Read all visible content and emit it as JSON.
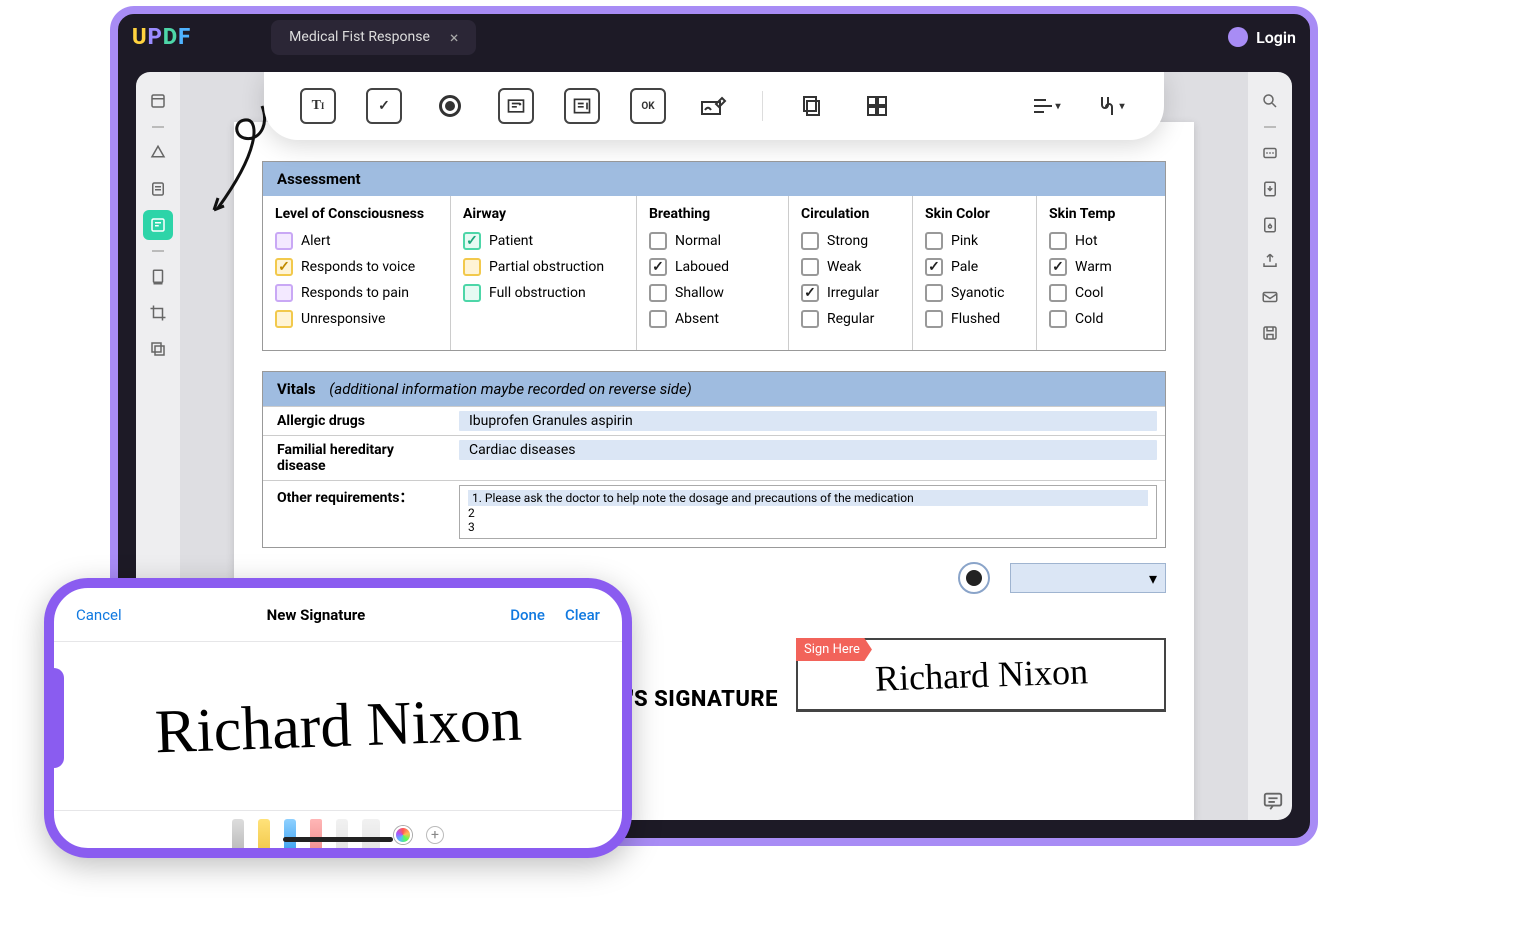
{
  "titlebar": {
    "logo": "UPDF",
    "tab": "Medical Fist Response",
    "login": "Login"
  },
  "toolbar": {
    "text_field": "T",
    "ok": "OK"
  },
  "assessment": {
    "title": "Assessment",
    "columns": [
      {
        "title": "Level of Consciousness",
        "style": "color",
        "options": [
          {
            "label": "Alert",
            "checked": false,
            "color": "purple"
          },
          {
            "label": "Responds to voice",
            "checked": true,
            "color": "yellow"
          },
          {
            "label": "Responds to pain",
            "checked": false,
            "color": "purple"
          },
          {
            "label": "Unresponsive",
            "checked": false,
            "color": "yellow"
          }
        ]
      },
      {
        "title": "Airway",
        "style": "color",
        "options": [
          {
            "label": "Patient",
            "checked": true,
            "color": "green"
          },
          {
            "label": "Partial obstruction",
            "checked": false,
            "color": "yellow"
          },
          {
            "label": "Full obstruction",
            "checked": false,
            "color": "green"
          }
        ]
      },
      {
        "title": "Breathing",
        "style": "plain",
        "options": [
          {
            "label": "Normal",
            "checked": false
          },
          {
            "label": "Laboued",
            "checked": true
          },
          {
            "label": "Shallow",
            "checked": false
          },
          {
            "label": "Absent",
            "checked": false
          }
        ]
      },
      {
        "title": "Circulation",
        "style": "plain",
        "options": [
          {
            "label": "Strong",
            "checked": false
          },
          {
            "label": "Weak",
            "checked": false
          },
          {
            "label": "Irregular",
            "checked": true
          },
          {
            "label": "Regular",
            "checked": false
          }
        ]
      },
      {
        "title": "Skin Color",
        "style": "plain",
        "options": [
          {
            "label": "Pink",
            "checked": false
          },
          {
            "label": "Pale",
            "checked": true
          },
          {
            "label": "Syanotic",
            "checked": false
          },
          {
            "label": "Flushed",
            "checked": false
          }
        ]
      },
      {
        "title": "Skin Temp",
        "style": "plain",
        "options": [
          {
            "label": "Hot",
            "checked": false
          },
          {
            "label": "Warm",
            "checked": true
          },
          {
            "label": "Cool",
            "checked": false
          },
          {
            "label": "Cold",
            "checked": false
          }
        ]
      }
    ]
  },
  "vitals": {
    "title": "Vitals",
    "subtitle": "(additional information maybe recorded on reverse side)",
    "rows": [
      {
        "label": "Allergic drugs",
        "value": "Ibuprofen Granules  aspirin"
      },
      {
        "label": "Familial hereditary disease",
        "value": "Cardiac diseases"
      }
    ],
    "other_label": "Other requirements：",
    "other_lines": [
      "1. Please ask the doctor to help note the dosage and precautions of the medication",
      "2",
      "3"
    ]
  },
  "signature": {
    "label": "T'S SIGNATURE",
    "sign_here": "Sign Here",
    "name": "Richard Nixon"
  },
  "phone": {
    "cancel": "Cancel",
    "title": "New Signature",
    "done": "Done",
    "clear": "Clear",
    "name": "Richard Nixon"
  }
}
